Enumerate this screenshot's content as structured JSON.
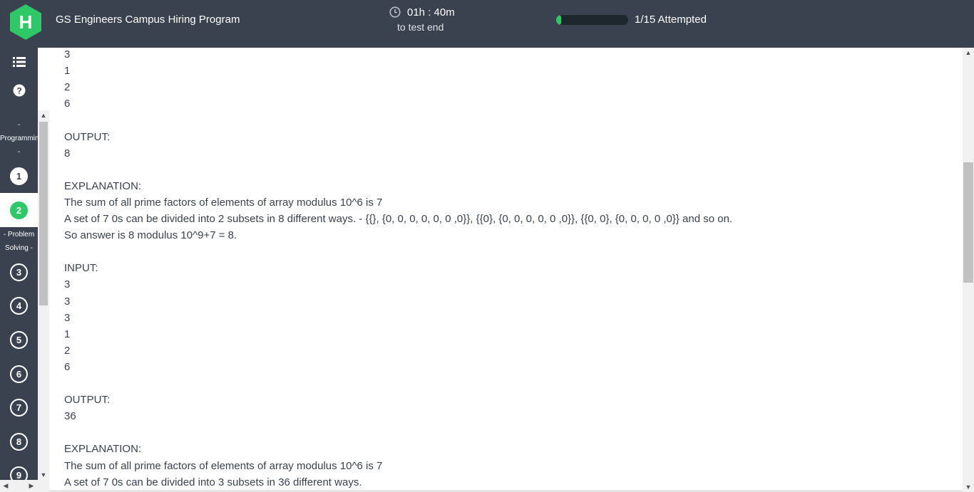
{
  "header": {
    "logo_letter": "H",
    "title": "GS Engineers Campus Hiring Program",
    "timer": {
      "time": "01h : 40m",
      "subtitle": "to test end"
    },
    "progress": {
      "label": "1/15 Attempted",
      "fraction": 0.0667
    }
  },
  "sidebar": {
    "icons": [
      "list-icon",
      "help-icon"
    ],
    "sections": [
      {
        "label_lines": [
          "-",
          "Programmin",
          "-"
        ]
      },
      {
        "label_lines": [
          "- Problem",
          "Solving -"
        ]
      }
    ],
    "questions": [
      {
        "num": "1",
        "state": "attempted"
      },
      {
        "num": "2",
        "state": "current"
      },
      {
        "num": "3",
        "state": "unattempted"
      },
      {
        "num": "4",
        "state": "unattempted"
      },
      {
        "num": "5",
        "state": "unattempted"
      },
      {
        "num": "6",
        "state": "unattempted"
      },
      {
        "num": "7",
        "state": "unattempted"
      },
      {
        "num": "8",
        "state": "unattempted"
      },
      {
        "num": "9",
        "state": "unattempted"
      }
    ]
  },
  "content": {
    "lines": [
      "3",
      "1",
      "2",
      "6",
      "",
      "OUTPUT:",
      "8",
      "",
      "EXPLANATION:",
      "The sum of all prime factors of elements of array modulus 10^6 is 7",
      "A set of 7 0s can be divided into 2 subsets in 8 different ways. - {{}, {0, 0, 0, 0, 0, 0 ,0}}, {{0}, {0, 0, 0, 0, 0 ,0}}, {{0, 0}, {0, 0, 0, 0 ,0}} and so on.",
      "So answer is 8 modulus 10^9+7 = 8.",
      "",
      "INPUT:",
      "3",
      "3",
      "3",
      "1",
      "2",
      "6",
      "",
      "OUTPUT:",
      "36",
      "",
      "EXPLANATION:",
      "The sum of all prime factors of elements of array modulus 10^6 is 7",
      "A set of 7 0s can be divided into 3 subsets in 36 different ways."
    ]
  },
  "colors": {
    "header_bg": "#39424e",
    "accent_green": "#2ec866",
    "text": "#39424e"
  }
}
